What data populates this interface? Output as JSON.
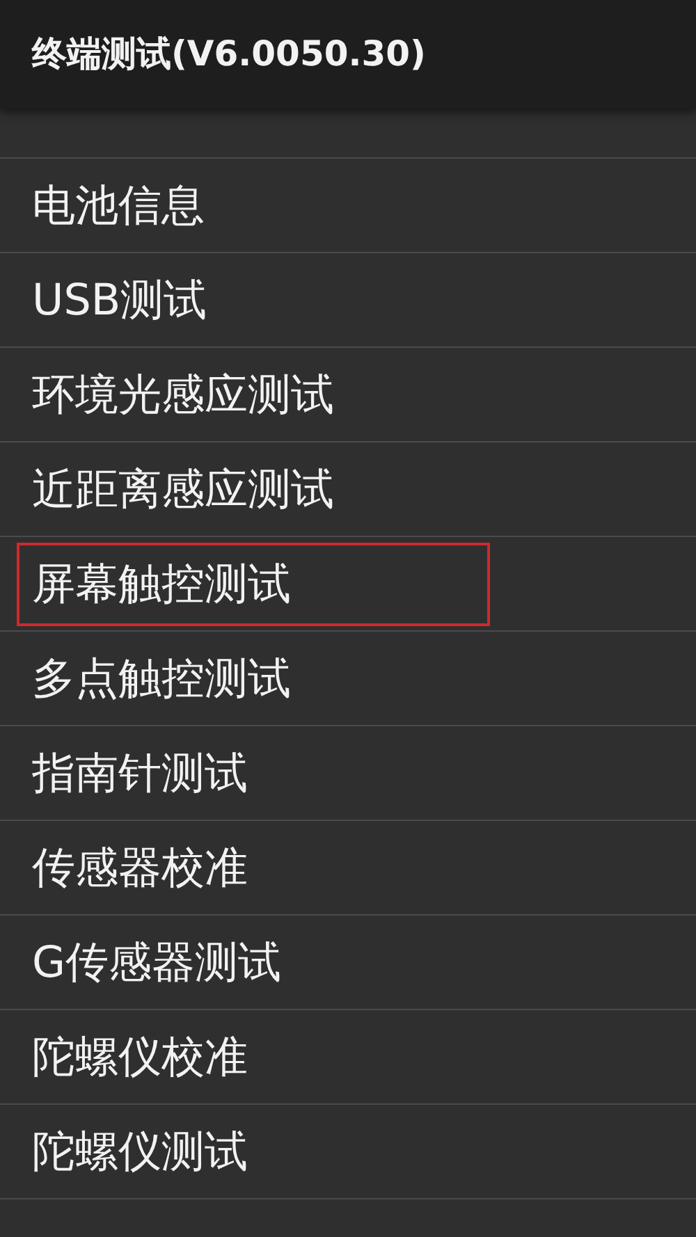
{
  "title_bar": {
    "title": "终端测试(V6.0050.30)"
  },
  "items": [
    {
      "label": "电池信息",
      "highlighted": false
    },
    {
      "label": "USB测试",
      "highlighted": false
    },
    {
      "label": "环境光感应测试",
      "highlighted": false
    },
    {
      "label": "近距离感应测试",
      "highlighted": false
    },
    {
      "label": "屏幕触控测试",
      "highlighted": true
    },
    {
      "label": "多点触控测试",
      "highlighted": false
    },
    {
      "label": "指南针测试",
      "highlighted": false
    },
    {
      "label": "传感器校准",
      "highlighted": false
    },
    {
      "label": "G传感器测试",
      "highlighted": false
    },
    {
      "label": "陀螺仪校准",
      "highlighted": false
    },
    {
      "label": "陀螺仪测试",
      "highlighted": false
    }
  ]
}
